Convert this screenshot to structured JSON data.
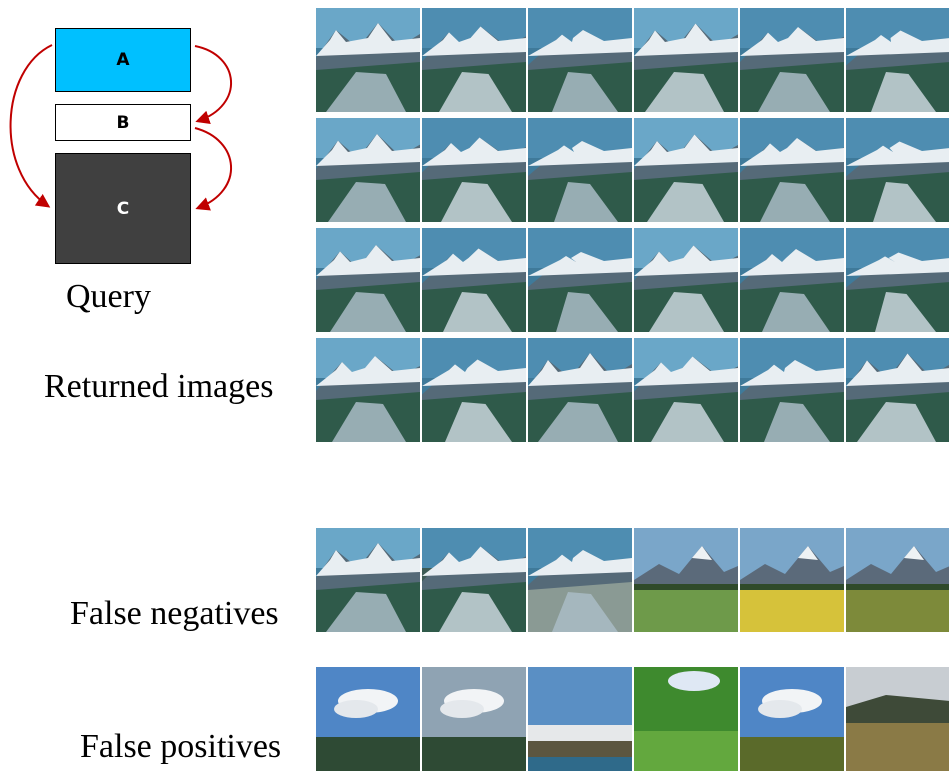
{
  "query_diagram": {
    "boxes": [
      {
        "id": "A",
        "label": "A",
        "color": "#00c0ff"
      },
      {
        "id": "B",
        "label": "B",
        "color": "#ffffff"
      },
      {
        "id": "C",
        "label": "C",
        "color": "#404040"
      }
    ],
    "arrow_color": "#c00000",
    "caption": "Query"
  },
  "sections": {
    "returned": {
      "label": "Returned images"
    },
    "false_negatives": {
      "label": "False negatives"
    },
    "false_positives": {
      "label": "False positives"
    }
  },
  "thumbnails": {
    "returned": [
      "mountain-glacier",
      "mountain-glacier",
      "mountain-glacier",
      "mountain-glacier",
      "mountain-glacier",
      "mountain-glacier",
      "mountain-glacier",
      "mountain-glacier",
      "mountain-glacier",
      "mountain-glacier",
      "mountain-glacier",
      "mountain-glacier",
      "mountain-glacier",
      "mountain-glacier",
      "mountain-glacier",
      "mountain-glacier",
      "mountain-glacier",
      "mountain-glacier",
      "mountain-glacier",
      "mountain-glacier",
      "mountain-glacier",
      "mountain-glacier",
      "mountain-glacier",
      "mountain-glacier"
    ],
    "false_negatives": [
      "mountain-glacier",
      "mountain-valley",
      "mountain-lake",
      "mountain-meadow",
      "yellow-field",
      "corn-field"
    ],
    "false_positives": [
      "sky-clouds",
      "cloudy-sky",
      "coastal-village",
      "green-forest",
      "sky-field",
      "open-field"
    ]
  }
}
